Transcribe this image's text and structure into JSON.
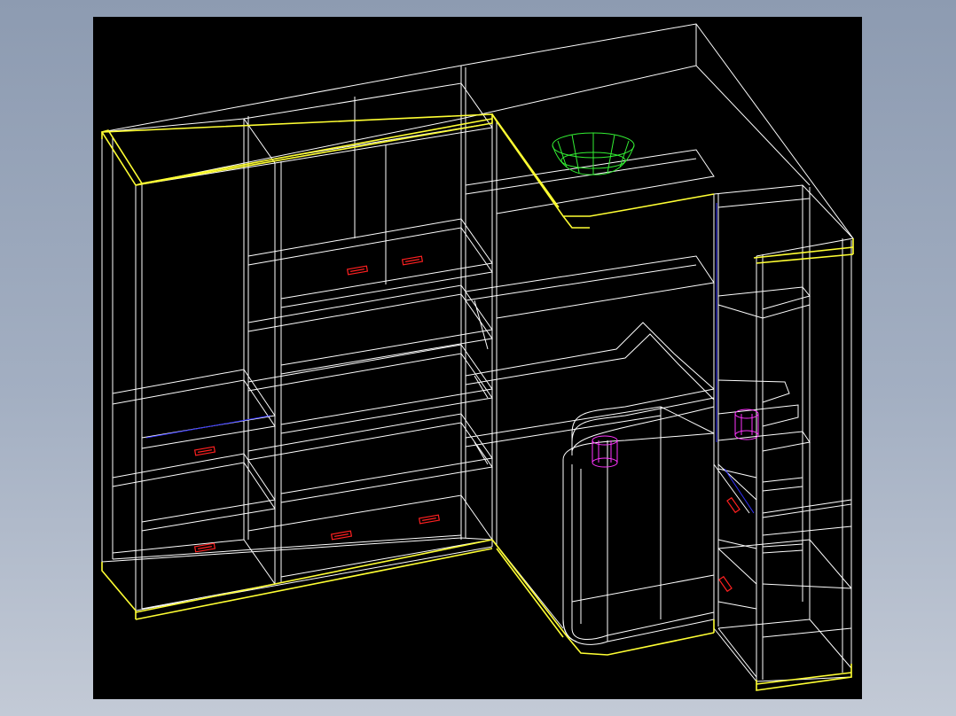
{
  "viewport": {
    "background": "#000000"
  },
  "colors": {
    "wireframe": "#ffffff",
    "edge_highlight": "#ffff33",
    "handle": "#ff2020",
    "cylinder": "#ff33ff",
    "bowl": "#33ee33",
    "hidden_edge": "#3333ff"
  },
  "model": {
    "subject": "corner-wardrobe-desk-wireframe",
    "bowl_icon": "bowl-icon",
    "handle_icon": "drawer-handle-icon",
    "cylinder_icon": "cylinder-icon"
  }
}
